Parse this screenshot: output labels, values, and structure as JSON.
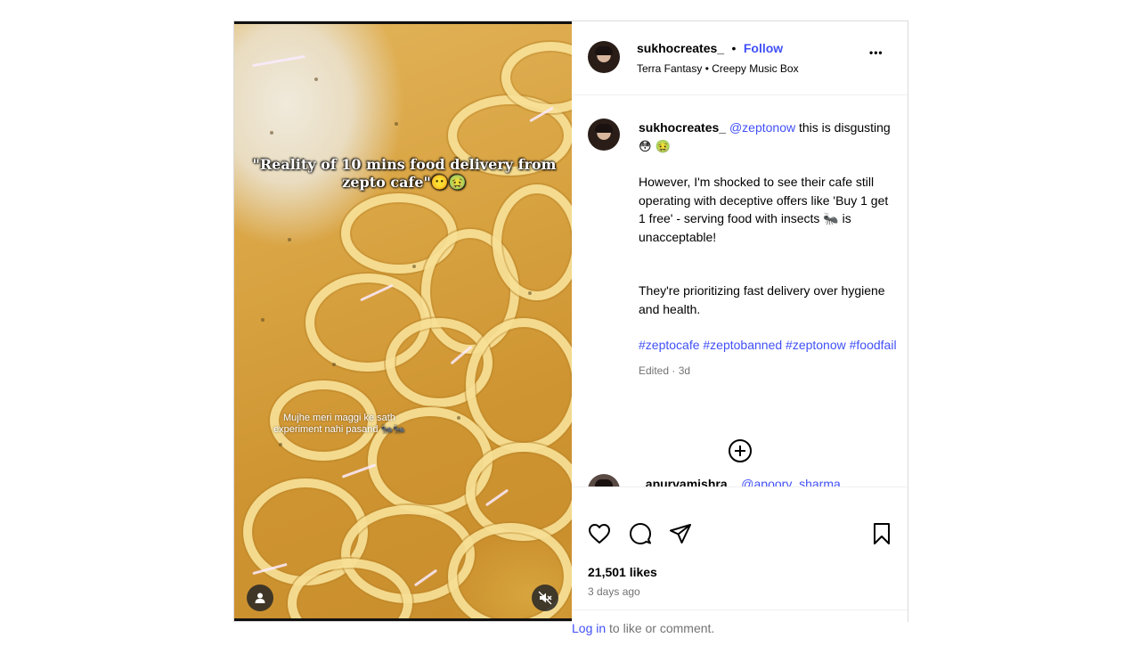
{
  "post": {
    "author": "sukhocreates_",
    "separator": "•",
    "follow_label": "Follow",
    "music": "Terra Fantasy • Creepy Music Box",
    "more_label": "•••"
  },
  "media": {
    "overlay_title": "\"Reality of 10 mins food delivery from zepto cafe\"😶🤢",
    "overlay_sub": "Mujhe meri maggi ke sath experiment nahi pasand 🐜🐜"
  },
  "caption": {
    "author": "sukhocreates_",
    "mention": "@zeptonow",
    "text_1": " this is disgusting 😳 🤢",
    "para_2": "However, I'm shocked to see their cafe still operating with deceptive offers like 'Buy 1 get 1 free' - serving food with insects 🐜 is unacceptable!",
    "para_3": "They're prioritizing fast delivery over hygiene and health.",
    "hashtags": "#zeptocafe #zeptobanned #zeptonow #foodfail",
    "edited": "Edited · 3d"
  },
  "next_comment": {
    "author": "_apurvamishra_",
    "mention": "@apoorv_sharma"
  },
  "stats": {
    "likes": "21,501 likes",
    "ago": "3 days ago"
  },
  "login": {
    "link": "Log in",
    "rest": " to like or comment."
  }
}
